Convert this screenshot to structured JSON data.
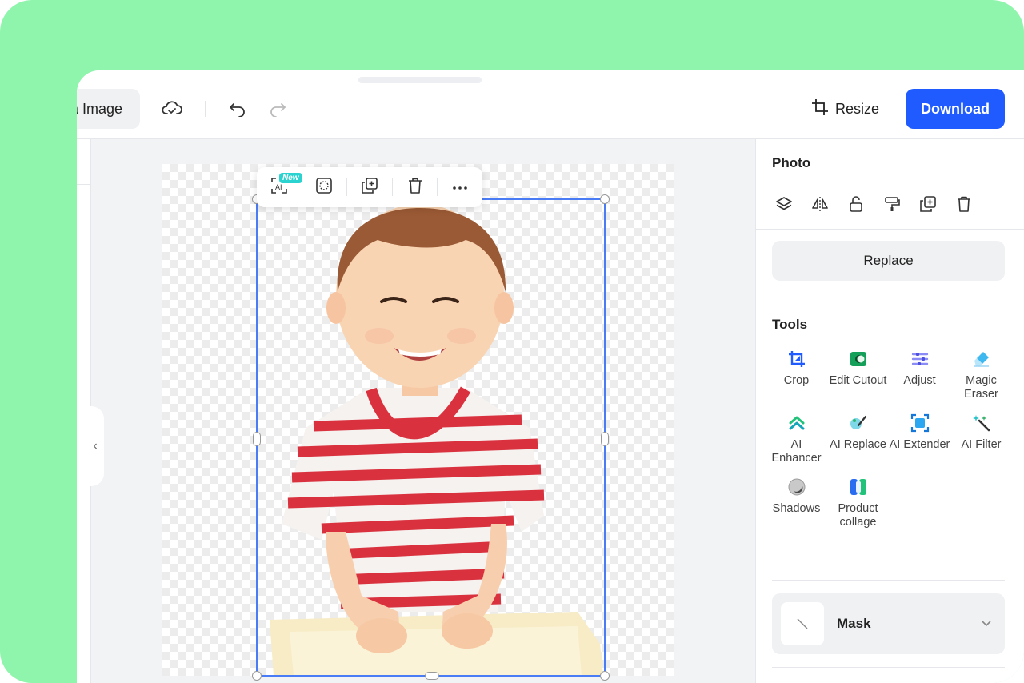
{
  "toolbar": {
    "image_label": "a Image",
    "resize_label": "Resize",
    "download_label": "Download"
  },
  "float_toolbar": {
    "new_badge": "New",
    "ai_label": "AI"
  },
  "panel": {
    "photo_title": "Photo",
    "photo_icons": [
      "layers-icon",
      "flip-icon",
      "lock-icon",
      "paint-roller-icon",
      "duplicate-icon",
      "trash-icon"
    ],
    "replace_label": "Replace",
    "tools_title": "Tools",
    "tools": [
      {
        "label": "Crop",
        "icon": "crop-icon"
      },
      {
        "label": "Edit Cutout",
        "icon": "edit-cutout-icon"
      },
      {
        "label": "Adjust",
        "icon": "adjust-icon"
      },
      {
        "label": "Magic Eraser",
        "icon": "magic-eraser-icon"
      },
      {
        "label": "AI Enhancer",
        "icon": "ai-enhancer-icon"
      },
      {
        "label": "AI Replace",
        "icon": "ai-replace-icon"
      },
      {
        "label": "AI Extender",
        "icon": "ai-extender-icon"
      },
      {
        "label": "AI Filter",
        "icon": "ai-filter-icon"
      },
      {
        "label": "Shadows",
        "icon": "shadows-icon"
      },
      {
        "label": "Product collage",
        "icon": "product-collage-icon"
      }
    ],
    "mask_label": "Mask"
  },
  "colors": {
    "accent": "#1f5bff",
    "background": "#8ff5ac",
    "selection": "#4a7cf6"
  }
}
